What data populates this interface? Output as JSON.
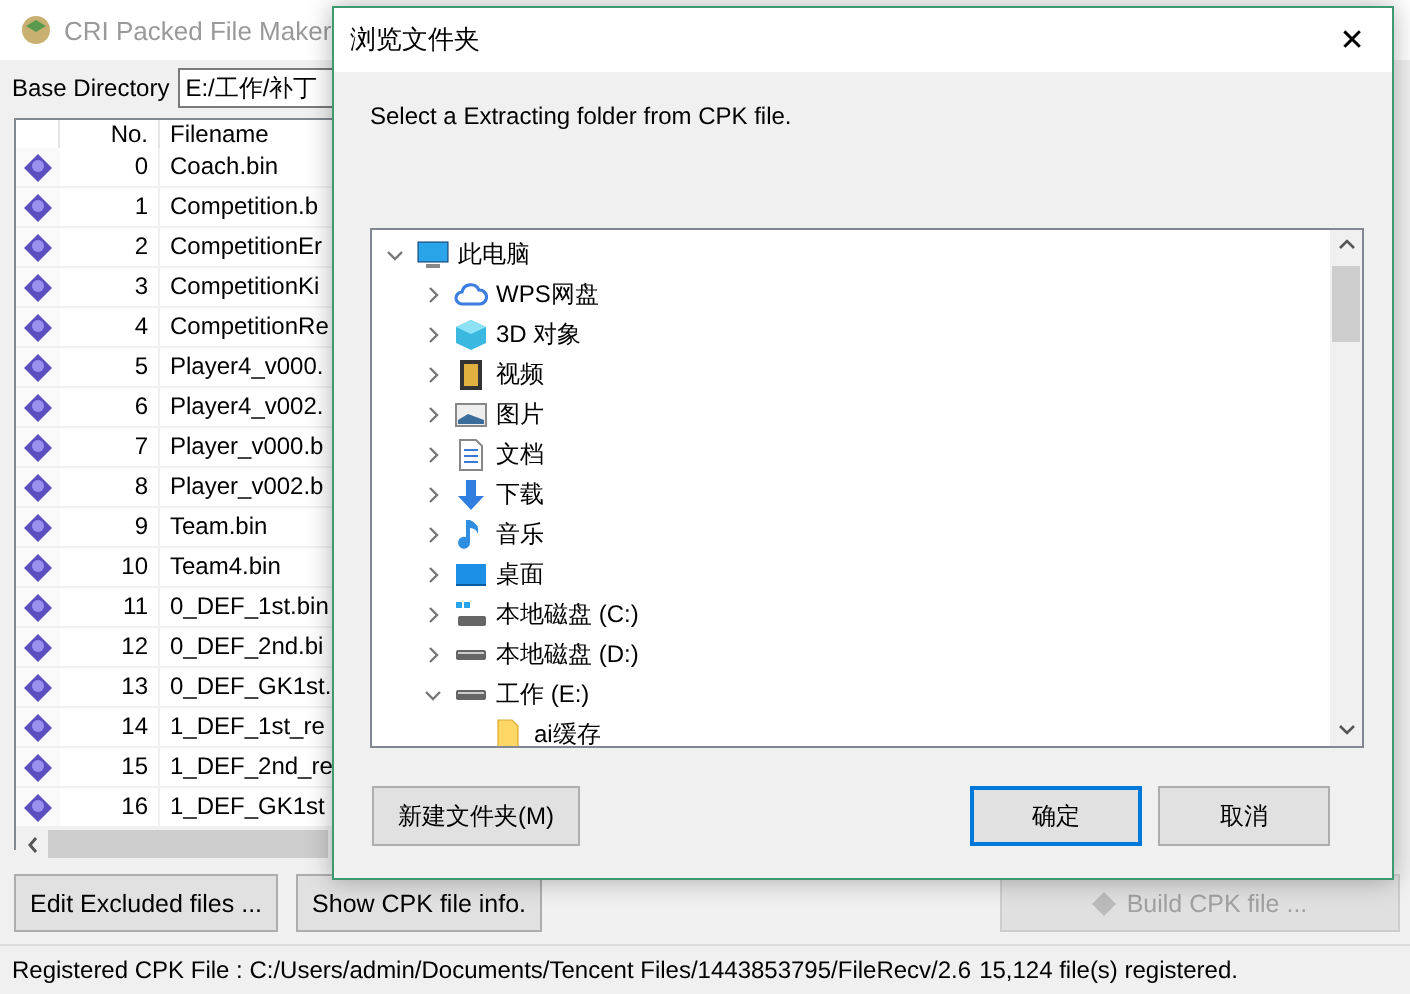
{
  "window": {
    "title": "CRI Packed File Maker"
  },
  "base_directory": {
    "label": "Base Directory",
    "value": "E:/工作/补丁"
  },
  "table": {
    "columns": [
      "No.",
      "Filename"
    ],
    "rows": [
      {
        "no": "0",
        "filename": "Coach.bin"
      },
      {
        "no": "1",
        "filename": "Competition.b"
      },
      {
        "no": "2",
        "filename": "CompetitionEr"
      },
      {
        "no": "3",
        "filename": "CompetitionKi"
      },
      {
        "no": "4",
        "filename": "CompetitionRe"
      },
      {
        "no": "5",
        "filename": "Player4_v000."
      },
      {
        "no": "6",
        "filename": "Player4_v002."
      },
      {
        "no": "7",
        "filename": "Player_v000.b"
      },
      {
        "no": "8",
        "filename": "Player_v002.b"
      },
      {
        "no": "9",
        "filename": "Team.bin"
      },
      {
        "no": "10",
        "filename": "Team4.bin"
      },
      {
        "no": "11",
        "filename": "0_DEF_1st.bin"
      },
      {
        "no": "12",
        "filename": "0_DEF_2nd.bi"
      },
      {
        "no": "13",
        "filename": "0_DEF_GK1st."
      },
      {
        "no": "14",
        "filename": "1_DEF_1st_re"
      },
      {
        "no": "15",
        "filename": "1_DEF_2nd_re"
      },
      {
        "no": "16",
        "filename": "1_DEF_GK1st"
      }
    ]
  },
  "buttons": [
    {
      "label": "Edit Excluded files ...",
      "disabled": false
    },
    {
      "label": "Show CPK file info.",
      "disabled": false
    },
    {
      "label": "Build CPK file ...",
      "disabled": true
    }
  ],
  "status_bar": {
    "path": "Registered CPK File : C:/Users/admin/Documents/Tencent Files/1443853795/FileRecv/2.6",
    "count": "15,124 file(s) registered."
  },
  "dialog": {
    "title": "浏览文件夹",
    "close": "✕",
    "prompt": "Select a Extracting folder from CPK file.",
    "tree": [
      {
        "label": "此电脑",
        "kind": "computer",
        "expanded": true,
        "children": [
          {
            "label": "WPS网盘",
            "kind": "cloud",
            "expanded": false
          },
          {
            "label": "3D 对象",
            "kind": "cube",
            "expanded": false
          },
          {
            "label": "视频",
            "kind": "video",
            "expanded": false
          },
          {
            "label": "图片",
            "kind": "image",
            "expanded": false
          },
          {
            "label": "文档",
            "kind": "document",
            "expanded": false
          },
          {
            "label": "下载",
            "kind": "download",
            "expanded": false
          },
          {
            "label": "音乐",
            "kind": "music",
            "expanded": false
          },
          {
            "label": "桌面",
            "kind": "desktop",
            "expanded": false
          },
          {
            "label": "本地磁盘 (C:)",
            "kind": "system-drive",
            "expanded": false
          },
          {
            "label": "本地磁盘 (D:)",
            "kind": "drive",
            "expanded": false
          },
          {
            "label": "工作 (E:)",
            "kind": "drive",
            "expanded": true,
            "children": [
              {
                "label": "ai缓存",
                "kind": "folder"
              }
            ]
          }
        ]
      }
    ],
    "buttons": [
      {
        "label": "新建文件夹(M)",
        "default": false
      },
      {
        "label": "确定",
        "default": true
      },
      {
        "label": "取消",
        "default": false
      }
    ]
  }
}
